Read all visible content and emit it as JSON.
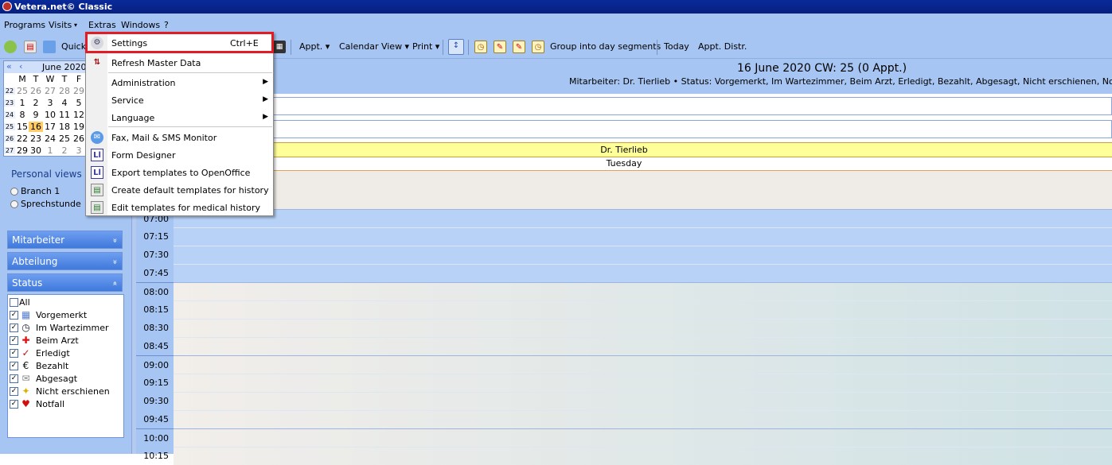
{
  "window": {
    "title": "Vetera.net© Classic"
  },
  "menubar": {
    "items": [
      "Programs",
      "Visits",
      "▾",
      "Extras",
      "Windows",
      "?"
    ]
  },
  "toolbar": {
    "quick_label": "Quick",
    "appt": "Appt. ▾",
    "calendar_view": "Calendar View ▾",
    "print": "Print ▾",
    "group": "Group into day segments",
    "today": "Today",
    "appt_distr": "Appt. Distr."
  },
  "calendar": {
    "month": "June 2020",
    "nav_prev": "«",
    "nav_prev2": "‹",
    "days": [
      "M",
      "T",
      "W",
      "T",
      "F"
    ],
    "weeks": [
      [
        "22",
        "25",
        "26",
        "27",
        "28",
        "29"
      ],
      [
        "23",
        "1",
        "2",
        "3",
        "4",
        "5"
      ],
      [
        "24",
        "8",
        "9",
        "10",
        "11",
        "12"
      ],
      [
        "25",
        "15",
        "16",
        "17",
        "18",
        "19"
      ],
      [
        "26",
        "22",
        "23",
        "24",
        "25",
        "26"
      ],
      [
        "27",
        "29",
        "30",
        "1",
        "2",
        "3"
      ]
    ]
  },
  "personal_views": {
    "title": "Personal views",
    "items": [
      "Branch 1",
      "Sprechstunde"
    ]
  },
  "panels": {
    "mitarbeiter": "Mitarbeiter",
    "abteilung": "Abteilung",
    "status": "Status",
    "chev_down": "»",
    "chev_up": "«"
  },
  "status_items": [
    {
      "label": "All",
      "checked": false
    },
    {
      "label": "Vorgemerkt",
      "checked": true,
      "icon": "calendar-icon"
    },
    {
      "label": "Im Wartezimmer",
      "checked": true,
      "icon": "clock-icon"
    },
    {
      "label": "Beim Arzt",
      "checked": true,
      "icon": "red-cross-icon"
    },
    {
      "label": "Erledigt",
      "checked": true,
      "icon": "check-icon"
    },
    {
      "label": "Bezahlt",
      "checked": true,
      "icon": "euro-icon"
    },
    {
      "label": "Abgesagt",
      "checked": true,
      "icon": "envelope-icon"
    },
    {
      "label": "Nicht erschienen",
      "checked": true,
      "icon": "lightbulb-icon"
    },
    {
      "label": "Notfall",
      "checked": true,
      "icon": "heart-icon"
    }
  ],
  "header": {
    "date": "16 June 2020  CW: 25 (0 Appt.)",
    "subtitle": "Mitarbeiter: Dr. Tierlieb  •  Status: Vorgemerkt, Im Wartezimmer, Beim Arzt, Erledigt, Bezahlt, Abgesagt, Nicht erschienen, Notfall"
  },
  "column": {
    "doctor": "Dr. Tierlieb",
    "day": "Tuesday"
  },
  "times": [
    "07:00",
    "07:15",
    "07:30",
    "07:45",
    "08:00",
    "08:15",
    "08:30",
    "08:45",
    "09:00",
    "09:15",
    "09:30",
    "09:45",
    "10:00",
    "10:15"
  ],
  "extras_menu": {
    "items": [
      {
        "label": "Settings",
        "shortcut": "Ctrl+E",
        "icon": "gear-icon"
      },
      {
        "label": "Refresh Master Data",
        "icon": "sort-icon"
      },
      {
        "label": "Administration",
        "submenu": true
      },
      {
        "label": "Service",
        "submenu": true
      },
      {
        "label": "Language",
        "submenu": true
      },
      {
        "label": "Fax, Mail & SMS Monitor",
        "icon": "monitor-icon"
      },
      {
        "label": "Form Designer",
        "icon": "form-icon"
      },
      {
        "label": "Export templates to OpenOffice",
        "icon": "form-icon"
      },
      {
        "label": "Create default templates for history",
        "icon": "printer-icon"
      },
      {
        "label": "Edit templates for medical history",
        "icon": "printer-icon"
      }
    ],
    "arrow": "▶"
  },
  "colors": {
    "accent": "#a6c5f3",
    "title": "#06207f",
    "highlight": "#e21b24",
    "doctor_band": "#ffff99"
  }
}
